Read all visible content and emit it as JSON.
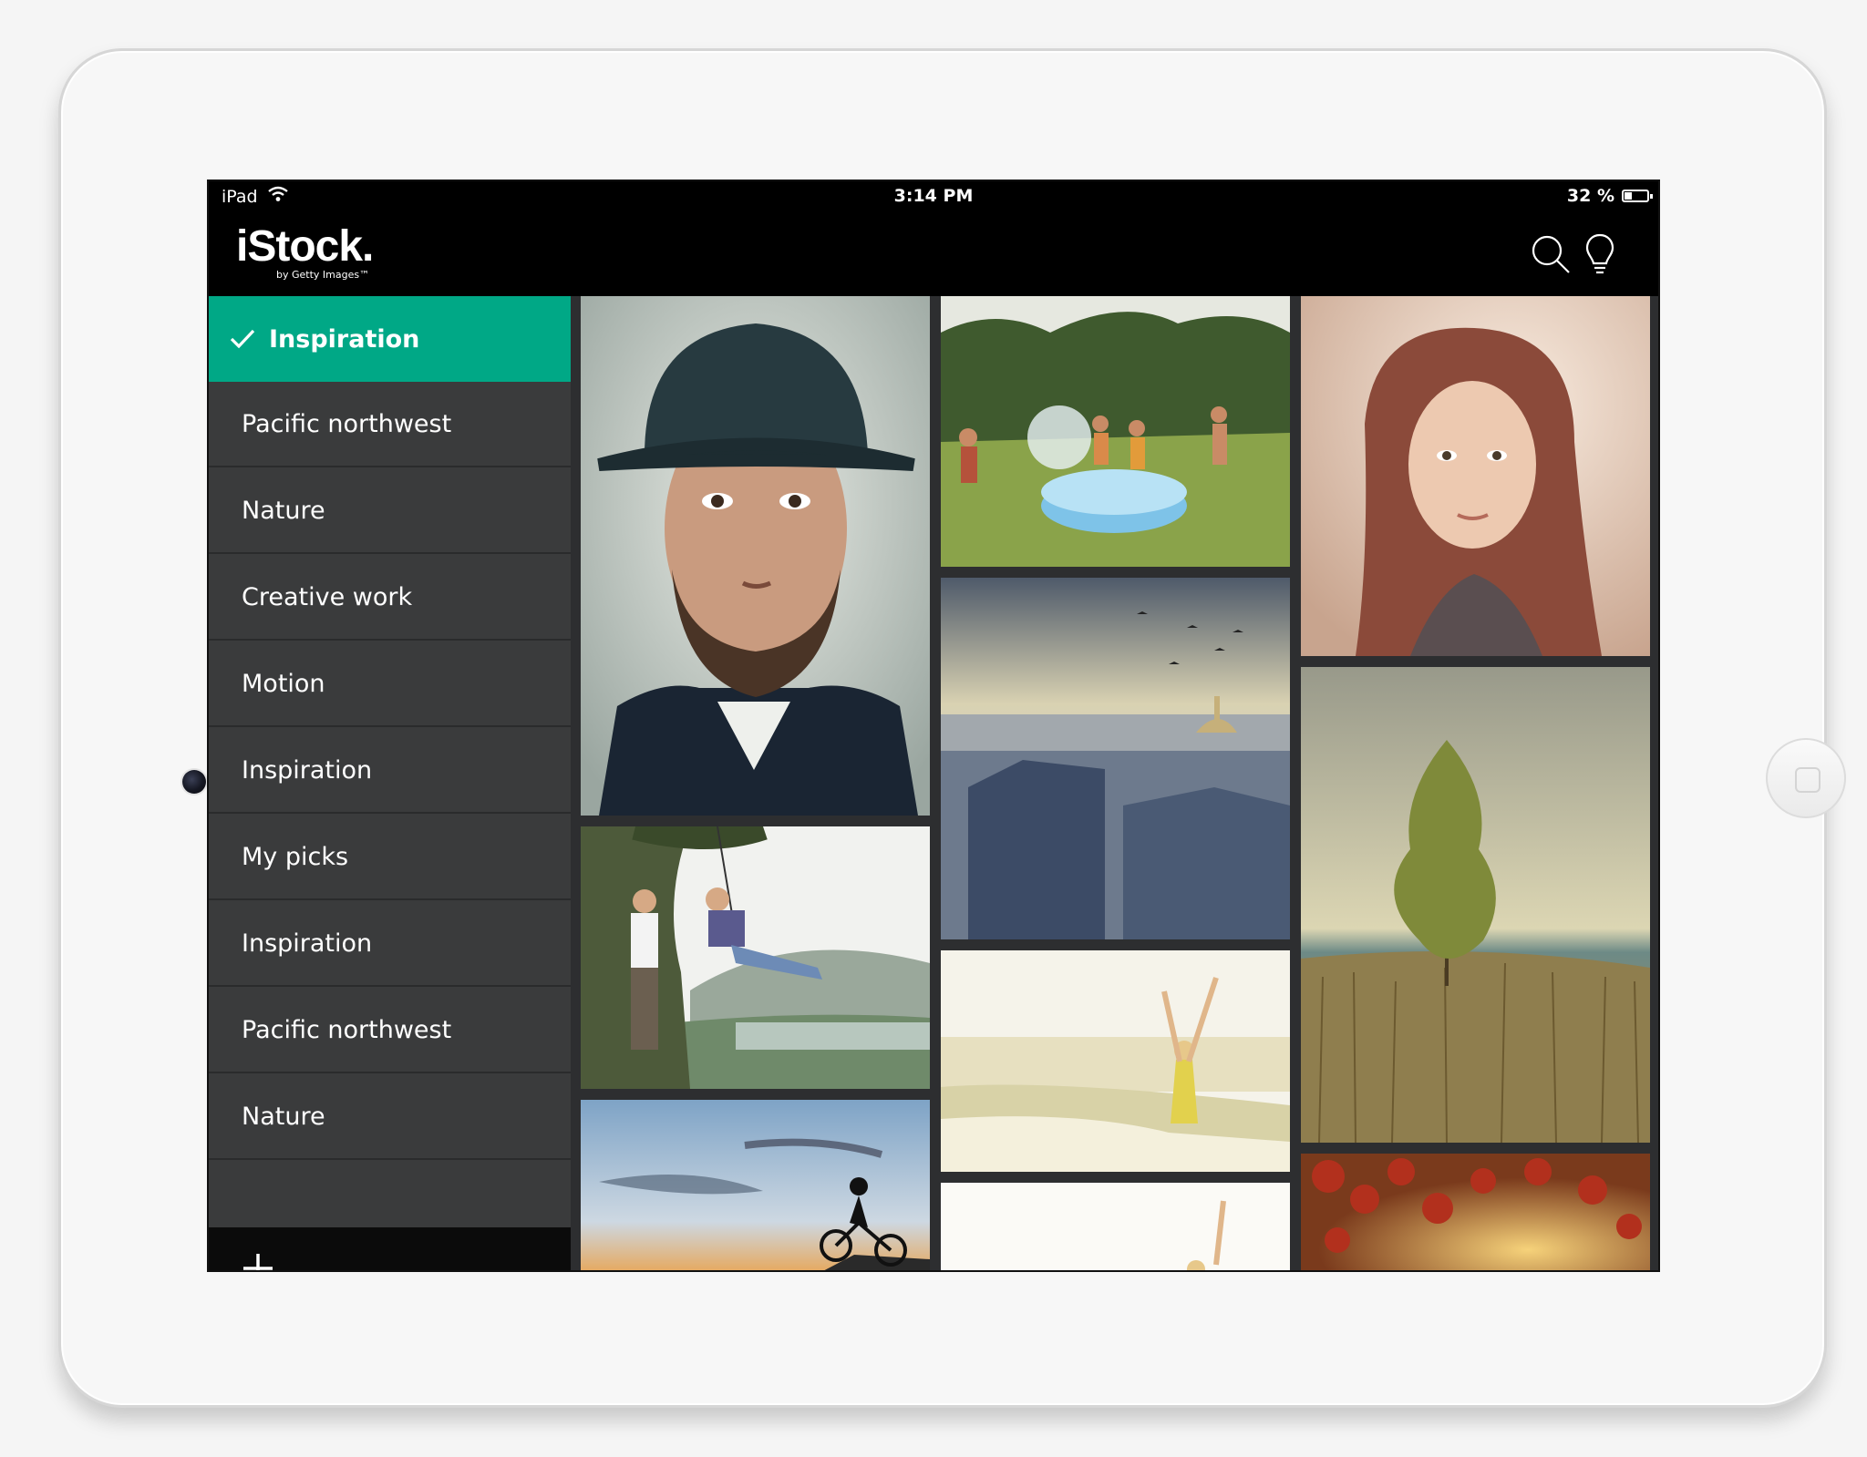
{
  "status_bar": {
    "device": "iPad",
    "time": "3:14 PM",
    "battery": "32 %",
    "battery_fraction": 0.32
  },
  "app": {
    "logo": "iStock.",
    "logo_sub": "by Getty Images™"
  },
  "toolbar": {
    "search_icon": "search-icon",
    "idea_icon": "lightbulb-icon",
    "accent": "#00a886"
  },
  "sidebar": {
    "items": [
      {
        "label": "Inspiration",
        "active": true
      },
      {
        "label": "Pacific northwest"
      },
      {
        "label": "Nature"
      },
      {
        "label": "Creative work"
      },
      {
        "label": "Motion"
      },
      {
        "label": "Inspiration"
      },
      {
        "label": "My picks"
      },
      {
        "label": "Inspiration"
      },
      {
        "label": "Pacific northwest"
      },
      {
        "label": "Nature"
      }
    ],
    "add_icon": "plus-icon"
  },
  "gallery": {
    "photos": [
      {
        "name": "man-with-hat-portrait"
      },
      {
        "name": "couple-swing-by-lake"
      },
      {
        "name": "bmx-rider-sky"
      },
      {
        "name": "kids-pool-water-fight"
      },
      {
        "name": "paris-rooftops-birds"
      },
      {
        "name": "woman-beach-arms-raised"
      },
      {
        "name": "woman-beach-partial"
      },
      {
        "name": "red-hair-woman-portrait"
      },
      {
        "name": "lone-tree-field-sea"
      },
      {
        "name": "autumn-leaves-sunset"
      }
    ]
  }
}
